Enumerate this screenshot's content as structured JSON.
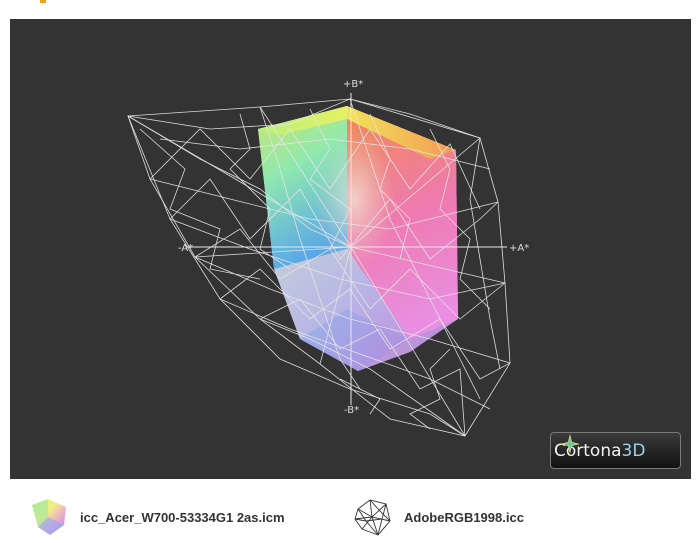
{
  "viewer": {
    "background": "#333333",
    "axes": {
      "b_plus": "+B*",
      "b_minus": "-B*",
      "a_plus": "+A*",
      "a_minus": "-A*"
    }
  },
  "badge": {
    "word": "Cortona",
    "suffix": "3D"
  },
  "legend": {
    "items": [
      {
        "label": "icc_Acer_W700-53334G1 2as.icm",
        "icon": "color-gamut-solid-icon"
      },
      {
        "label": "AdobeRGB1998.icc",
        "icon": "wireframe-gamut-icon"
      }
    ]
  }
}
